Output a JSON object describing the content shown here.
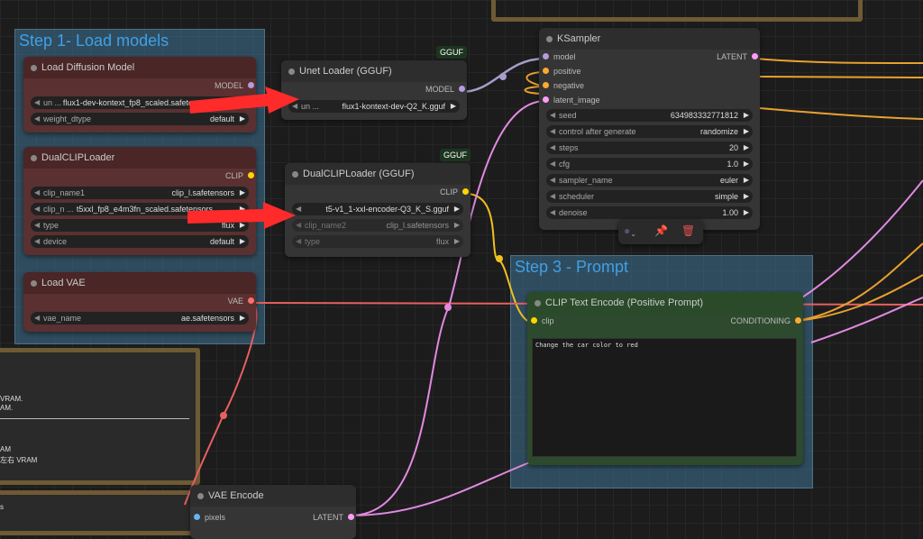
{
  "groups": {
    "step1_title": "Step 1- Load models",
    "step3_title": "Step 3 - Prompt"
  },
  "load_diffusion": {
    "title": "Load Diffusion Model",
    "output": "MODEL",
    "unet_label": "un ...",
    "unet_value": "flux1-dev-kontext_fp8_scaled.safetensors",
    "dtype_label": "weight_dtype",
    "dtype_value": "default"
  },
  "dualclip": {
    "title": "DualCLIPLoader",
    "output": "CLIP",
    "clip1_label": "clip_name1",
    "clip1_value": "clip_l.safetensors",
    "clip2_label": "clip_n ...",
    "clip2_value": "t5xxl_fp8_e4m3fn_scaled.safetensors",
    "type_label": "type",
    "type_value": "flux",
    "device_label": "device",
    "device_value": "default"
  },
  "load_vae": {
    "title": "Load VAE",
    "output": "VAE",
    "vae_label": "vae_name",
    "vae_value": "ae.safetensors"
  },
  "unet_gguf": {
    "title": "Unet Loader (GGUF)",
    "badge": "GGUF",
    "output": "MODEL",
    "unet_label": "un ...",
    "unet_value": "flux1-kontext-dev-Q2_K.gguf"
  },
  "dualclip_gguf": {
    "title": "DualCLIPLoader (GGUF)",
    "badge": "GGUF",
    "output": "CLIP",
    "clip1_value": "t5-v1_1-xxl-encoder-Q3_K_S.gguf",
    "clip2_label": "clip_name2",
    "clip2_value": "clip_l.safetensors",
    "type_label": "type",
    "type_value": "flux"
  },
  "ksampler": {
    "title": "KSampler",
    "inputs": [
      "model",
      "positive",
      "negative",
      "latent_image"
    ],
    "output": "LATENT",
    "seed_label": "seed",
    "seed_value": "634983332771812",
    "control_label": "control after generate",
    "control_value": "randomize",
    "steps_label": "steps",
    "steps_value": "20",
    "cfg_label": "cfg",
    "cfg_value": "1.0",
    "sampler_label": "sampler_name",
    "sampler_value": "euler",
    "scheduler_label": "scheduler",
    "scheduler_value": "simple",
    "denoise_label": "denoise",
    "denoise_value": "1.00"
  },
  "clip_text": {
    "title": "CLIP Text Encode (Positive Prompt)",
    "input": "clip",
    "output": "CONDITIONING",
    "prompt": "Change the car color to red"
  },
  "vae_encode": {
    "title": "VAE Encode",
    "input": "pixels",
    "output": "LATENT"
  },
  "note": {
    "line1": "VRAM.",
    "line2": "AM.",
    "line3": "AM",
    "line4": "左右 VRAM",
    "line5": "s"
  },
  "colors": {
    "model": "#b39ddb",
    "clip": "#ffd500",
    "vae": "#ff6e6e",
    "latent": "#ff9cf9",
    "conditioning": "#ffa931"
  }
}
